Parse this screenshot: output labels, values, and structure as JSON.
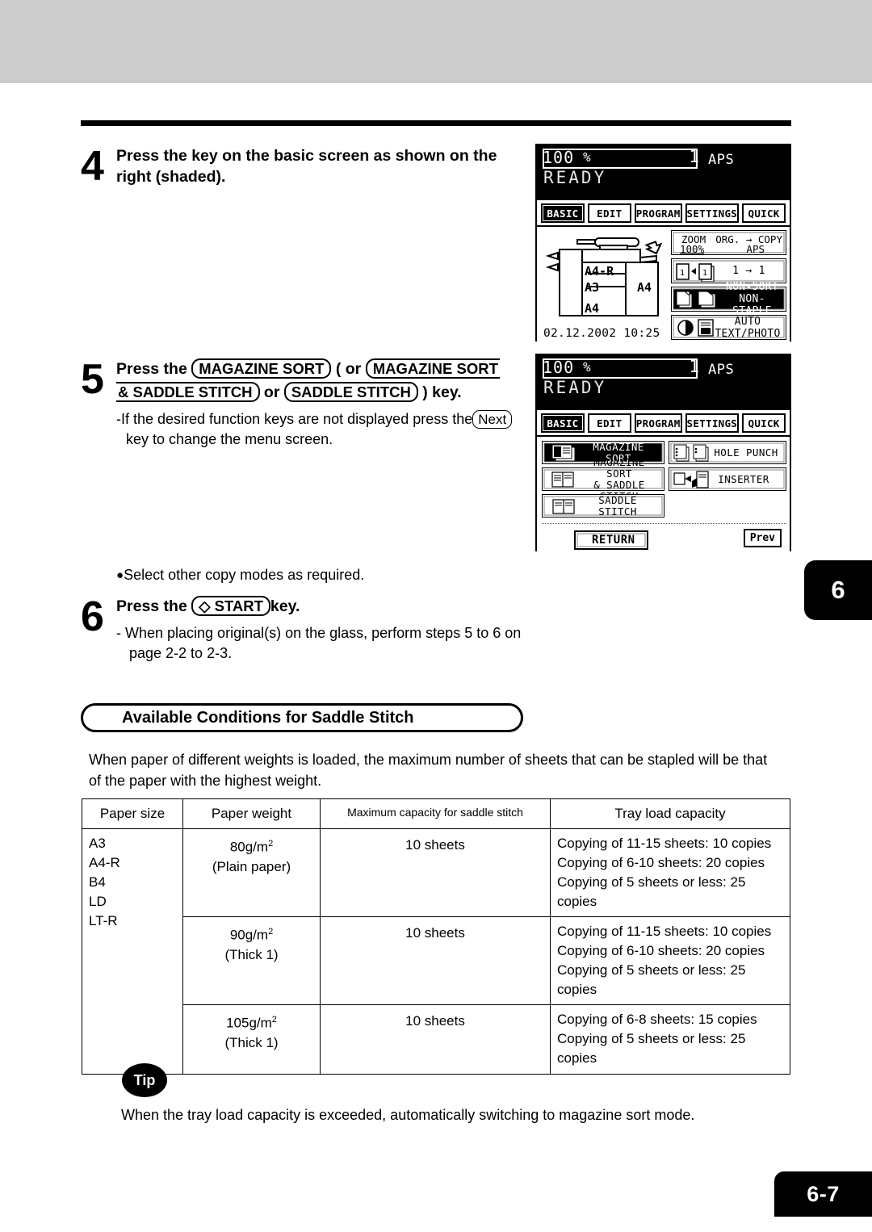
{
  "page": {
    "number": "6-7",
    "chapter_tab": "6"
  },
  "steps": [
    {
      "num": "4",
      "line1": "Press the key on the basic screen as shown on the",
      "line2": "right (shaded)."
    },
    {
      "num": "5",
      "press_the": "Press the",
      "key1": "MAGAZINE SORT",
      "paren_open": "( or",
      "key2a": "MAGAZINE SORT",
      "key2b": "& SADDLE STITCH",
      "or": "or",
      "key3": "SADDLE STITCH",
      "tail": ") key.",
      "note_a": "-If the desired function keys are not displayed press the",
      "note_key": "Next",
      "note_b": "key to change the menu screen."
    },
    {
      "num": "6",
      "bullet": "Select other copy modes as required.",
      "press_the": "Press the",
      "start_key": "START",
      "start_glyph": "◇",
      "key_word": "key.",
      "note_a": "-  When placing original(s) on the glass, perform steps 5 to 6 on",
      "note_b": "page 2-2 to 2-3."
    }
  ],
  "lcd_basic": {
    "ratio": "100",
    "percent": "%",
    "copies": "1",
    "aps": "APS",
    "status": "READY",
    "tabs": [
      {
        "label": "BASIC",
        "active": true
      },
      {
        "label": "EDIT",
        "active": false
      },
      {
        "label": "PROGRAM",
        "active": false
      },
      {
        "label": "SETTINGS",
        "active": false
      },
      {
        "label": "QUICK",
        "active": false
      }
    ],
    "trays": [
      "A4-R",
      "A3",
      "A4"
    ],
    "bypass_tray": "A4",
    "datetime": "02.12.2002 10:25",
    "function_buttons": [
      {
        "name": "zoom",
        "l1": "ZOOM",
        "l2": "100%",
        "r1": "ORG. → COPY",
        "r2": "APS",
        "selected": false
      },
      {
        "name": "duplex",
        "text": "1  →  1",
        "selected": false
      },
      {
        "name": "finishing",
        "l1": "NON-SORT",
        "l2": "NON-STAPLE",
        "selected": true
      },
      {
        "name": "original-mode",
        "l1": "AUTO",
        "l2": "TEXT/PHOTO",
        "selected": false
      }
    ]
  },
  "lcd_menu": {
    "ratio": "100",
    "percent": "%",
    "copies": "1",
    "aps": "APS",
    "status": "READY",
    "tabs": [
      {
        "label": "BASIC",
        "active": true
      },
      {
        "label": "EDIT",
        "active": false
      },
      {
        "label": "PROGRAM",
        "active": false
      },
      {
        "label": "SETTINGS",
        "active": false
      },
      {
        "label": "QUICK",
        "active": false
      }
    ],
    "buttons_left": [
      {
        "l1": "MAGAZINE SORT",
        "l2": "",
        "selected": true
      },
      {
        "l1": "MAGAZINE SORT",
        "l2": "& SADDLE STITCH",
        "selected": false
      },
      {
        "l1": "SADDLE STITCH",
        "l2": "",
        "selected": false
      }
    ],
    "buttons_right": [
      {
        "l1": "HOLE PUNCH",
        "l2": "",
        "selected": false
      },
      {
        "l1": "INSERTER",
        "l2": "",
        "selected": false
      }
    ],
    "return_label": "RETURN",
    "prev_label": "Prev"
  },
  "section": {
    "heading": "Available Conditions for Saddle Stitch",
    "paragraph_line1": "When paper of different weights is loaded, the maximum number of sheets that can be stapled will be that",
    "paragraph_line2": "of the paper with the highest weight."
  },
  "table": {
    "headers": [
      "Paper size",
      "Paper weight",
      "Maximum capacity for saddle stitch",
      "Tray load capacity"
    ],
    "paper_sizes": [
      "A3",
      "A4-R",
      "B4",
      "LD",
      "LT-R"
    ],
    "rows": [
      {
        "weight_l1": "80g/m",
        "weight_sup": "2",
        "weight_l2": "(Plain paper)",
        "capacity": "10 sheets",
        "tray": [
          "Copying of 11-15 sheets: 10 copies",
          "Copying of 6-10 sheets: 20 copies",
          "Copying of 5 sheets or less: 25 copies"
        ]
      },
      {
        "weight_l1": "90g/m",
        "weight_sup": "2",
        "weight_l2": "(Thick 1)",
        "capacity": "10 sheets",
        "tray": [
          "Copying of 11-15 sheets: 10 copies",
          "Copying of 6-10 sheets: 20 copies",
          "Copying of 5 sheets or less: 25 copies"
        ]
      },
      {
        "weight_l1": "105g/m",
        "weight_sup": "2",
        "weight_l2": "(Thick 1)",
        "capacity": "10 sheets",
        "tray": [
          "Copying of 6-8 sheets: 15 copies",
          "Copying of 5 sheets or less: 25 copies"
        ]
      }
    ]
  },
  "tip": {
    "badge": "Tip",
    "text": "When the tray load capacity is exceeded, automatically switching to magazine sort mode."
  }
}
